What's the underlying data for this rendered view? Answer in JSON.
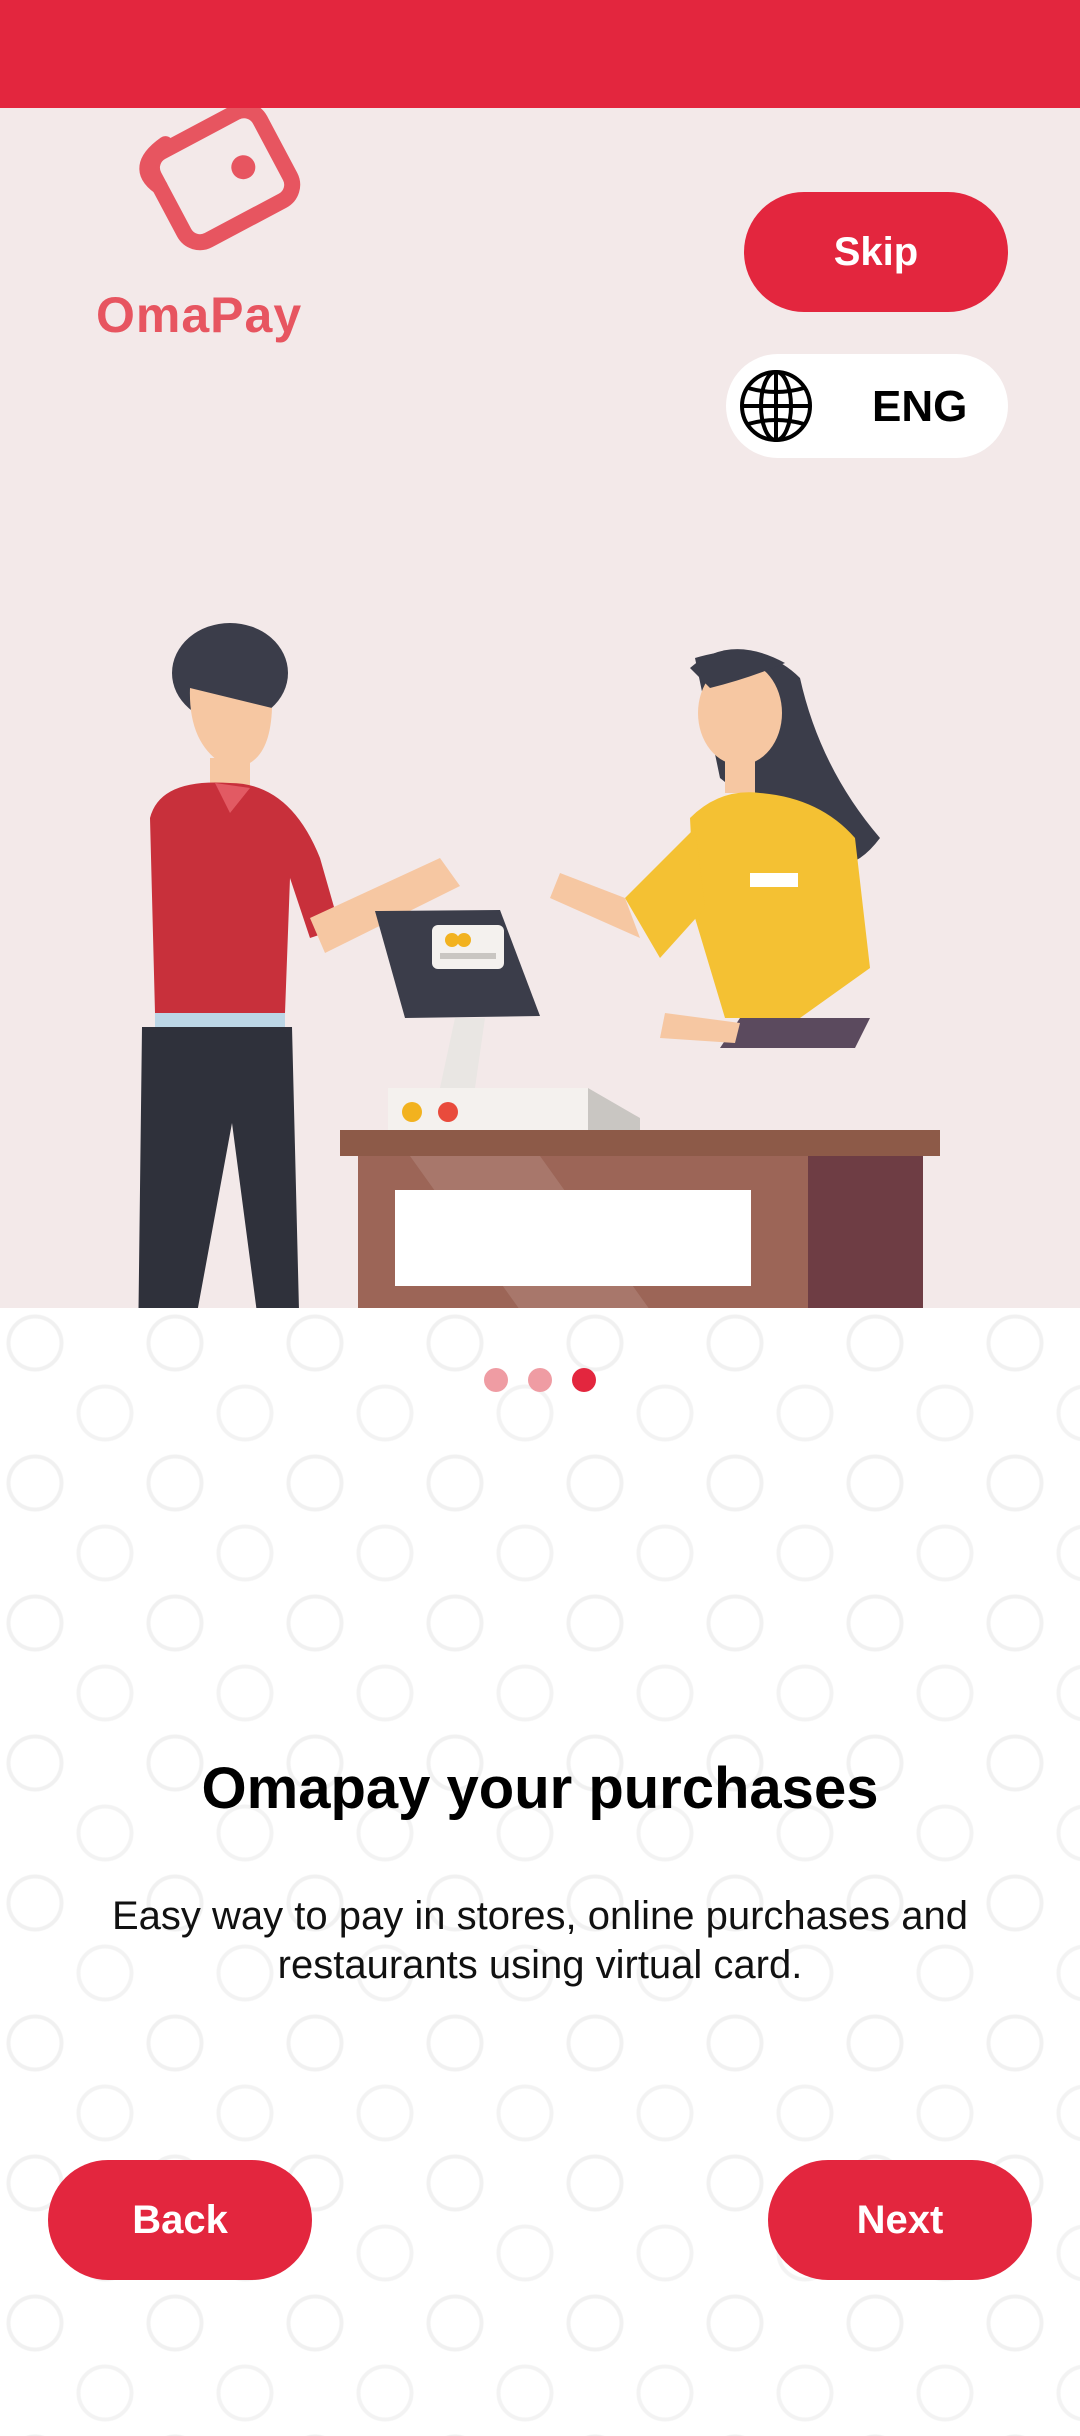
{
  "colors": {
    "accent": "#e3263e",
    "hero_bg": "#f3e9e9",
    "dot_inactive": "#ef9ca3",
    "dot_active": "#e3263e"
  },
  "logo": {
    "text": "OmaPay",
    "icon": "wallet-logo-icon"
  },
  "header": {
    "skip_label": "Skip",
    "language_label": "ENG",
    "language_icon": "globe-icon"
  },
  "carousel": {
    "total_pages": 3,
    "current_page": 3
  },
  "content": {
    "title": "Omapay your purchases",
    "description": "Easy way to pay in stores, online purchases and restaurants using virtual card."
  },
  "footer": {
    "back_label": "Back",
    "next_label": "Next"
  }
}
